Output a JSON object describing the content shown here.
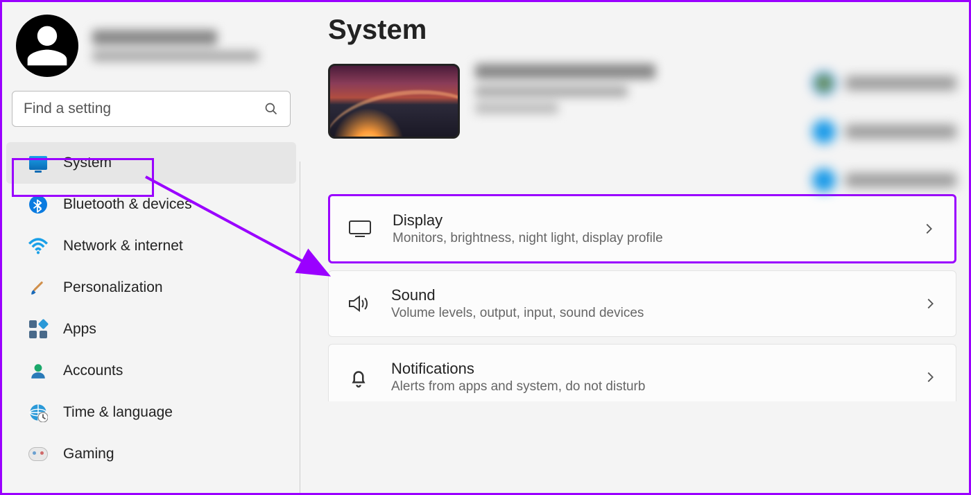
{
  "search": {
    "placeholder": "Find a setting"
  },
  "page": {
    "title": "System"
  },
  "nav": {
    "items": [
      {
        "label": "System"
      },
      {
        "label": "Bluetooth & devices"
      },
      {
        "label": "Network & internet"
      },
      {
        "label": "Personalization"
      },
      {
        "label": "Apps"
      },
      {
        "label": "Accounts"
      },
      {
        "label": "Time & language"
      },
      {
        "label": "Gaming"
      }
    ]
  },
  "cards": {
    "display": {
      "title": "Display",
      "sub": "Monitors, brightness, night light, display profile"
    },
    "sound": {
      "title": "Sound",
      "sub": "Volume levels, output, input, sound devices"
    },
    "notifications": {
      "title": "Notifications",
      "sub": "Alerts from apps and system, do not disturb"
    }
  },
  "colors": {
    "highlight": "#9a00ff"
  }
}
